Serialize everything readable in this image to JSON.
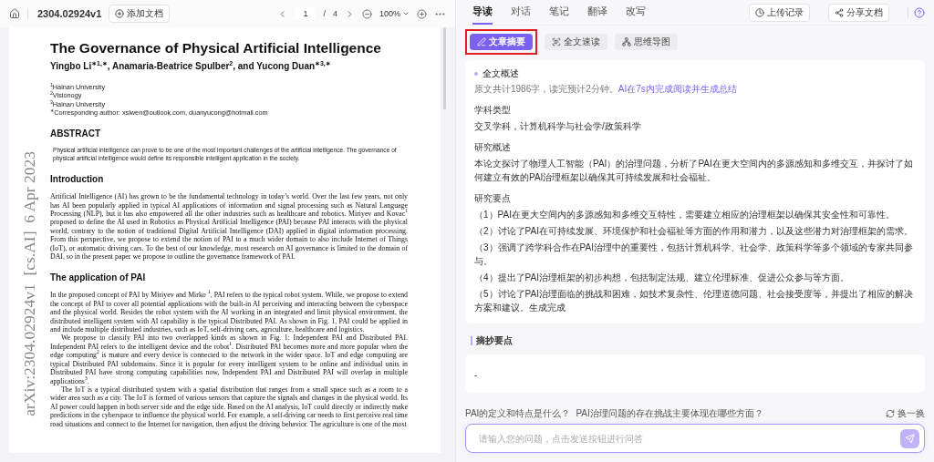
{
  "doc_toolbar": {
    "title": "2304.02924v1",
    "add_button": "添加文档",
    "page_current": "1",
    "page_separator": "/",
    "page_total": "4",
    "zoom": "100%"
  },
  "paper": {
    "stamp": "arXiv:2304.02924v1  [cs.AI]  6 Apr 2023",
    "title": "The Governance of Physical Artificial Intelligence",
    "authors": "Yingbo Li$^{∗1,∗}$, Anamaria-Beatrice Spulber$^{2}$, and Yucong Duan$^{∗3,∗}$",
    "affiliations": [
      "$^{1}$Hainan University",
      "$^{2}$Visionogy",
      "$^{3}$Hainan University",
      "$^{∗}$Corresponding author: xslwen@outlook.com, duanyucong@hotmail.com"
    ],
    "abstract_heading": "ABSTRACT",
    "abstract": "Physical artificial intelligence can prove to be one of the most important challenges of the artificial intelligence. The governance of physical artificial intelligence would define its responsible intelligent application in the society.",
    "sections": [
      {
        "heading": "Introduction",
        "paragraphs": [
          "Artificial Intelligence (AI) has grown to be the fundamental technology in today’s world. Over the last few years, not only has AI been popularly applied in typical AI applications of information and signal processing such as Natural Language Processing (NLP), but it has also empowered all the other industries such as healthcare and robotics. Miriyev and Kovac$^{1}$ proposed to define the AI used in Robotics as Physical Artificial Intelligence (PAI) because PAI interacts with the physical world, contrary to the notion of traditional Digital Artificial Intelligence (DAI) applied in digital information processing. From this perspective, we propose to extend the notion of PAI to a much wider domain to also include Internet of Things (IoT), or automatic driving cars. To the best of our knowledge, most research on AI governance is limited to the domain of DAI, so in the present paper we propose to outline the governance framework of PAI."
        ]
      },
      {
        "heading": "The application of PAI",
        "paragraphs": [
          "In the proposed concept of PAI by Miriyev and Mirko $^{1}$, PAI refers to the typical robot system. While, we propose to extend the concept of PAI to cover all potential applications with the built-in AI perceiving and interacting between the cyberspace and the physical world. Besides the robot system with the AI working in an integrated and limit physical environment, the distributed intelligent system with AI capability is the typical Distributed PAI. As shown in Fig. 1, PAI could be applied in and include multiple distributed industries, such as IoT, self-driving cars, agriculture, healthcare and logistics.",
          "We propose to classify PAI into two overlapped kinds as shown in Fig. 1: Independent PAI and Distributed PAI. Independent PAI refers to the intelligent device and the robot$^{1}$. Distributed PAI becomes more and more popular when the edge computing$^{2}$ is mature and every device is connected to the network in the wider space. IoT and edge computing are typical Distributed PAI subdomains. Since it is popular for every intelligent system to be online and individual units in Distributed PAI have strong computing capabilities now, Independent PAI and Distributed PAI will overlap in multiple applications$^{3}$.",
          "The IoT is a typical distributed system with a spatial distribution that ranges from a small space such as a room to a wider area such as a city. The IoT is formed of various sensors that capture the signals and changes in the physical world. Its AI power could happen in both server side and the edge side. Based on the AI analysis, IoT could directly or indirectly make predictions in the cyberspace to influence the physical world. For example, a self-driving car needs to first perceive real time road situations and connect to the Internet for navigation, then adjust the driving behavior. The agriculture is one of the most"
        ]
      }
    ]
  },
  "tabs": [
    {
      "label": "导读",
      "selected": true
    },
    {
      "label": "对话",
      "selected": false
    },
    {
      "label": "笔记",
      "selected": false
    },
    {
      "label": "翻译",
      "selected": false
    },
    {
      "label": "改写",
      "selected": false
    }
  ],
  "header_buttons": [
    {
      "kind": "history",
      "label": "上传记录"
    },
    {
      "kind": "share",
      "label": "分享文档"
    }
  ],
  "subtabs": [
    {
      "kind": "summary",
      "label": "文章摘要",
      "selected": true,
      "highlighted": true
    },
    {
      "kind": "speed",
      "label": "全文速读",
      "selected": false,
      "highlighted": false
    },
    {
      "kind": "mindmap",
      "label": "思维导图",
      "selected": false,
      "highlighted": false
    }
  ],
  "summary": {
    "heading": "全文概述",
    "meta": "原文共计1986字，读完预计2分钟。",
    "meta_link": "AI在7s内完成阅读并生成总结",
    "sections": [
      {
        "heading": "学科类型",
        "body": [
          "交叉学科，计算机科学与社会学/政策科学"
        ]
      },
      {
        "heading": "研究概述",
        "body": [
          "本论文探讨了物理人工智能（PAI）的治理问题，分析了PAI在更大空间内的多源感知和多维交互，并探讨了如何建立有效的PAI治理框架以确保其可持续发展和社会福祉。"
        ]
      },
      {
        "heading": "研究要点",
        "body": [
          "（1）PAI在更大空间内的多源感知和多维交互特性，需要建立相应的治理框架以确保其安全性和可靠性。",
          "（2）讨论了PAI在可持续发展、环境保护和社会福祉等方面的作用和潜力，以及这些潜力对治理框架的需求。",
          "（3）强调了跨学科合作在PAI治理中的重要性，包括计算机科学、社会学、政策科学等多个领域的专家共同参与。",
          "（4）提出了PAI治理框架的初步构想，包括制定法规、建立伦理标准、促进公众参与等方面。",
          "（5）讨论了PAI治理面临的挑战和困难，如技术复杂性、伦理道德问题、社会接受度等，并提出了相应的解决方案和建议。生成完成"
        ]
      }
    ]
  },
  "excerpt": {
    "heading": "摘抄要点",
    "items": [
      "-"
    ]
  },
  "suggestions": [
    "PAI的定义和特点是什么？",
    "PAI治理问题的存在挑战主要体现在哪些方面？"
  ],
  "refresh": "换一换",
  "chat_input": {
    "placeholder": "请输入您的问题，点击发送按钮进行问答"
  }
}
